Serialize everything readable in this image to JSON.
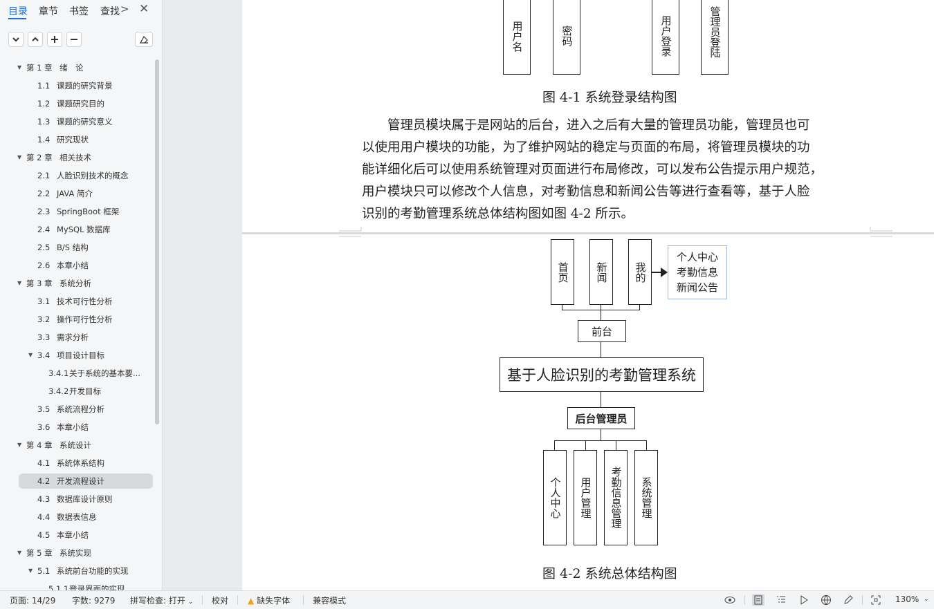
{
  "sidebar": {
    "tabs": [
      {
        "label": "目录",
        "active": true
      },
      {
        "label": "章节"
      },
      {
        "label": "书签"
      },
      {
        "label": "查找"
      }
    ],
    "more_glyph": ">",
    "close_glyph": "✕",
    "toc": [
      {
        "level": 0,
        "arrow": "▼",
        "num": "第 1 章",
        "text": "绪　论"
      },
      {
        "level": 1,
        "num": "1.1",
        "text": "课题的研究背景"
      },
      {
        "level": 1,
        "num": "1.2",
        "text": "课题研究目的"
      },
      {
        "level": 1,
        "num": "1.3",
        "text": "课题的研究意义"
      },
      {
        "level": 1,
        "num": "1.4",
        "text": "研究现状"
      },
      {
        "level": 0,
        "arrow": "▼",
        "num": "第 2 章",
        "text": "相关技术"
      },
      {
        "level": 1,
        "num": "2.1",
        "text": "人脸识别技术的概念"
      },
      {
        "level": 1,
        "num": "2.2",
        "text": "JAVA 简介"
      },
      {
        "level": 1,
        "num": "2.3",
        "text": "SpringBoot 框架"
      },
      {
        "level": 1,
        "num": "2.4",
        "text": "MySQL 数据库"
      },
      {
        "level": 1,
        "num": "2.5",
        "text": "B/S 结构"
      },
      {
        "level": 1,
        "num": "2.6",
        "text": "本章小结"
      },
      {
        "level": 0,
        "arrow": "▼",
        "num": "第 3 章",
        "text": "系统分析"
      },
      {
        "level": 1,
        "num": "3.1",
        "text": "技术可行性分析"
      },
      {
        "level": 1,
        "num": "3.2",
        "text": "操作可行性分析"
      },
      {
        "level": 1,
        "num": "3.3",
        "text": "需求分析"
      },
      {
        "level": 1,
        "arrow": "▼",
        "num": "3.4",
        "text": "项目设计目标"
      },
      {
        "level": 2,
        "num": "3.4.1",
        "text": "关于系统的基本要..."
      },
      {
        "level": 2,
        "num": "3.4.2",
        "text": "开发目标"
      },
      {
        "level": 1,
        "num": "3.5",
        "text": "系统流程分析"
      },
      {
        "level": 1,
        "num": "3.6",
        "text": "本章小结"
      },
      {
        "level": 0,
        "arrow": "▼",
        "num": "第 4 章",
        "text": "系统设计"
      },
      {
        "level": 1,
        "num": "4.1",
        "text": "系统体系结构"
      },
      {
        "level": 1,
        "num": "4.2",
        "text": "开发流程设计",
        "selected": true
      },
      {
        "level": 1,
        "num": "4.3",
        "text": "数据库设计原则"
      },
      {
        "level": 1,
        "num": "4.4",
        "text": "数据表信息"
      },
      {
        "level": 1,
        "num": "4.5",
        "text": "本章小结"
      },
      {
        "level": 0,
        "arrow": "▼",
        "num": "第 5 章",
        "text": "系统实现"
      },
      {
        "level": 1,
        "arrow": "▼",
        "num": "5.1",
        "text": "系统前台功能的实现"
      },
      {
        "level": 2,
        "num": "5.1.1",
        "text": "登录界面的实现"
      }
    ]
  },
  "doc": {
    "fig1": {
      "boxes": [
        "用户名",
        "密码",
        "用户登录",
        "管理员登陆"
      ],
      "caption": "图 4-1  系统登录结构图"
    },
    "paragraph_lines": [
      "管理员模块属于是网站的后台，进入之后有大量的管理员功能，管理员也可",
      "以使用用户模块的功能，为了维护网站的稳定与页面的布局，将管理员模块的功",
      "能详细化后可以使用系统管理对页面进行布局修改，可以发布公告提示用户规范，",
      "用户模块只可以修改个人信息，对考勤信息和新闻公告等进行查看等，基于人脸",
      "识别的考勤管理系统总体结构图如图 4-2 所示。"
    ],
    "fig2": {
      "front_boxes": [
        "首页",
        "新闻",
        "我的"
      ],
      "my_sub": [
        "个人中心",
        "考勤信息",
        "新闻公告"
      ],
      "frontend": "前台",
      "system": "基于人脸识别的考勤管理系统",
      "backend": "后台管理员",
      "back_boxes": [
        "个人中心",
        "用户管理",
        "考勤信息管理",
        "系统管理"
      ],
      "caption": "图 4-2  系统总体结构图"
    }
  },
  "status": {
    "page": "页面: 14/29",
    "words": "字数: 9279",
    "spell": "拼写检查: 打开",
    "proof": "校对",
    "missing_font": "缺失字体",
    "compat": "兼容模式",
    "zoom": "130%"
  },
  "colors": {
    "accent": "#1a6fd6",
    "warning": "#f0a020"
  }
}
